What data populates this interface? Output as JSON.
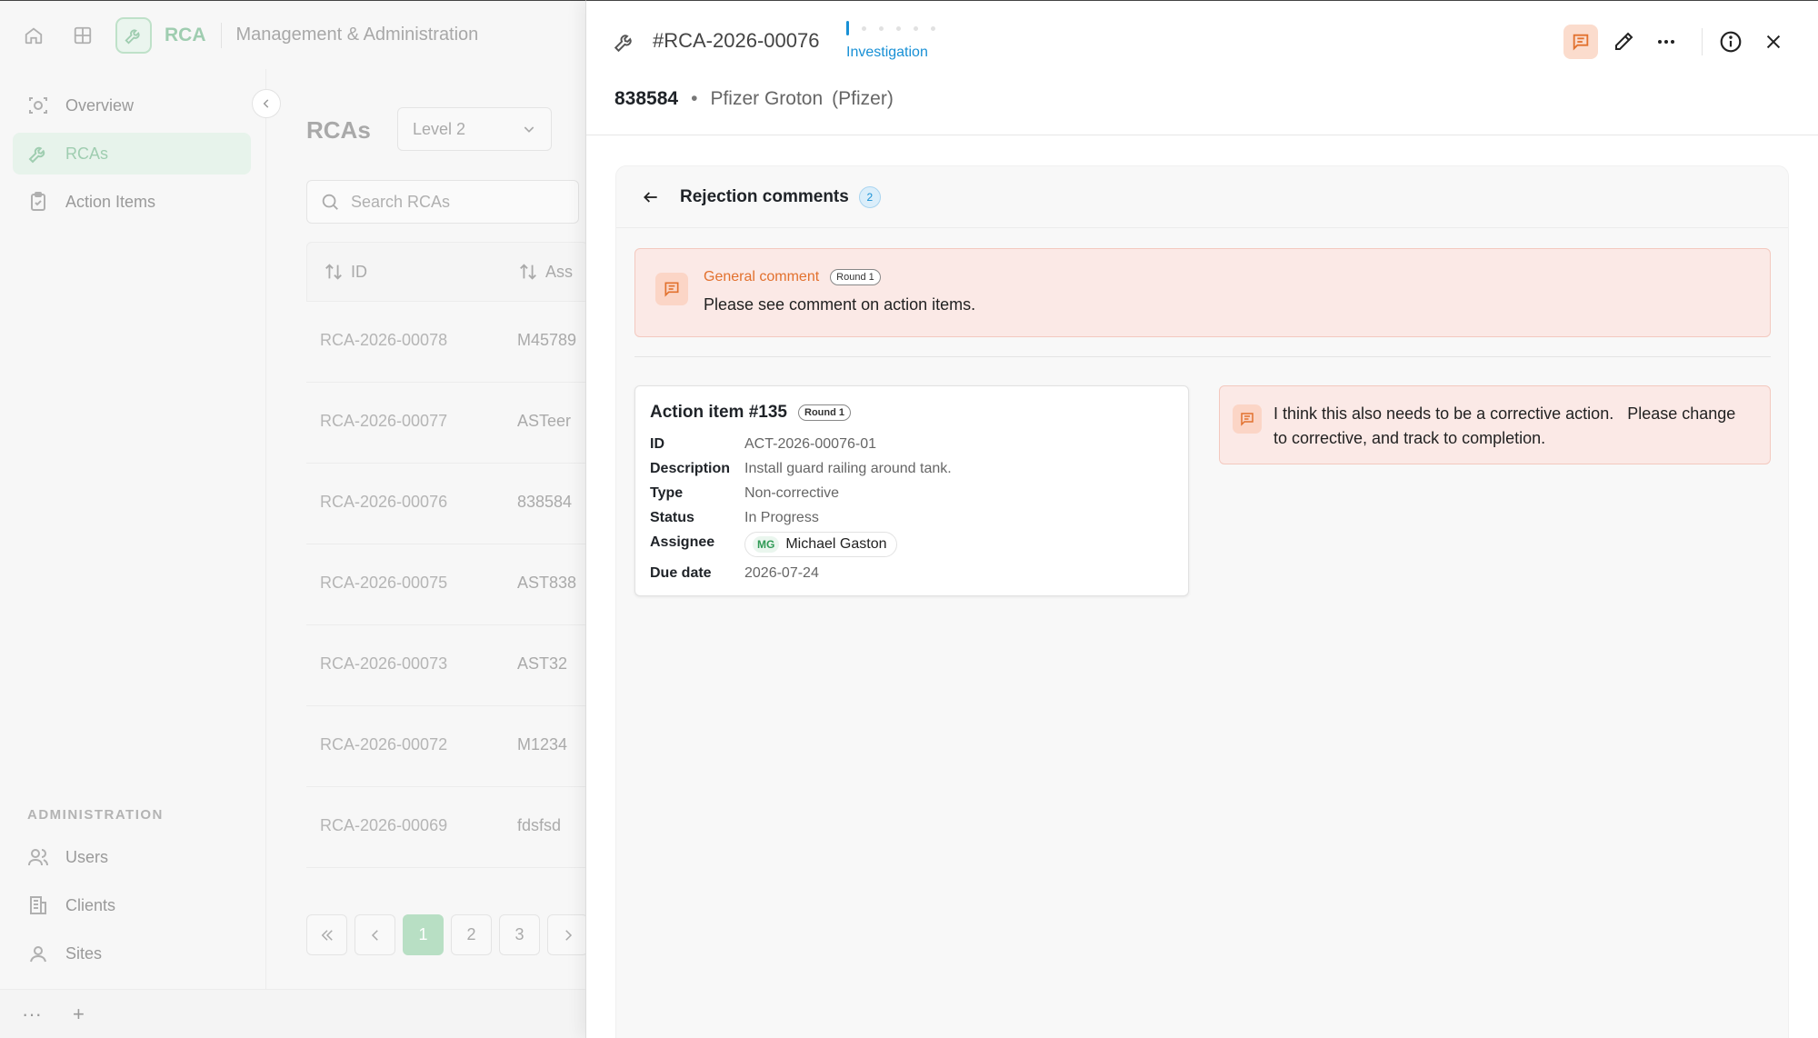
{
  "app": {
    "name": "RCA",
    "subtitle": "Management & Administration"
  },
  "sidebar": {
    "items": [
      {
        "label": "Overview",
        "icon": "overview-icon"
      },
      {
        "label": "RCAs",
        "icon": "wrench-icon",
        "active": true
      },
      {
        "label": "Action Items",
        "icon": "clipboard-check-icon"
      }
    ],
    "section_label": "ADMINISTRATION",
    "admin_items": [
      {
        "label": "Users",
        "icon": "users-icon"
      },
      {
        "label": "Clients",
        "icon": "building-icon"
      },
      {
        "label": "Sites",
        "icon": "user-pin-icon"
      }
    ],
    "bottom": {
      "more": "···",
      "add": "+"
    }
  },
  "list": {
    "title": "RCAs",
    "level_select": "Level 2",
    "search_placeholder": "Search RCAs",
    "columns": [
      "ID",
      "Ass"
    ],
    "rows": [
      {
        "id": "RCA-2026-00078",
        "asset": "M45789"
      },
      {
        "id": "RCA-2026-00077",
        "asset": "ASTeer"
      },
      {
        "id": "RCA-2026-00076",
        "asset": "838584"
      },
      {
        "id": "RCA-2026-00075",
        "asset": "AST838"
      },
      {
        "id": "RCA-2026-00073",
        "asset": "AST32"
      },
      {
        "id": "RCA-2026-00072",
        "asset": "M1234"
      },
      {
        "id": "RCA-2026-00069",
        "asset": "fdsfsd"
      }
    ],
    "pagination": {
      "pages": [
        "1",
        "2",
        "3"
      ],
      "current": "1"
    }
  },
  "drawer": {
    "rca_id": "#RCA-2026-00076",
    "stage": "Investigation",
    "asset": "838584",
    "separator": "•",
    "site": "Pfizer Groton",
    "client": "(Pfizer)",
    "panel": {
      "title": "Rejection comments",
      "count": "2",
      "general_comment": {
        "label": "General comment",
        "round": "Round 1",
        "text": "Please see comment on action items."
      },
      "action_item": {
        "title": "Action item #135",
        "round": "Round 1",
        "fields": {
          "id_label": "ID",
          "id_value": "ACT-2026-00076-01",
          "desc_label": "Description",
          "desc_value": "Install guard railing around tank.",
          "type_label": "Type",
          "type_value": "Non-corrective",
          "status_label": "Status",
          "status_value": "In Progress",
          "assignee_label": "Assignee",
          "assignee_initials": "MG",
          "assignee_name": "Michael Gaston",
          "due_label": "Due date",
          "due_value": "2026-07-24"
        },
        "comment": "I think this also needs to be a corrective action.   Please change to corrective, and track to completion."
      }
    }
  },
  "colors": {
    "accent_blue": "#1890d5",
    "comment_orange": "#e2712e",
    "comment_bg": "#fbe9e6",
    "brand_green": "#9fcdb0"
  }
}
